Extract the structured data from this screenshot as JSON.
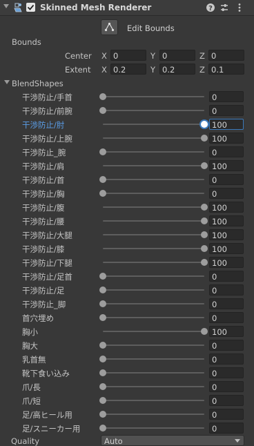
{
  "component": {
    "title": "Skinned Mesh Renderer",
    "enabled": true
  },
  "edit_bounds_label": "Edit Bounds",
  "bounds": {
    "label": "Bounds",
    "center": {
      "label": "Center",
      "x": "0",
      "y": "0",
      "z": "0"
    },
    "extent": {
      "label": "Extent",
      "x": "0.2",
      "y": "0.2",
      "z": "0.1"
    },
    "axis_labels": {
      "x": "X",
      "y": "Y",
      "z": "Z"
    }
  },
  "blendshapes": {
    "label": "BlendShapes",
    "items": [
      {
        "name": "干渉防止/手首",
        "value": "0"
      },
      {
        "name": "干渉防止/前腕",
        "value": "0"
      },
      {
        "name": "干渉防止/肘",
        "value": "100"
      },
      {
        "name": "干渉防止/上腕",
        "value": "100"
      },
      {
        "name": "干渉防止_腕",
        "value": "0"
      },
      {
        "name": "干渉防止/肩",
        "value": "100"
      },
      {
        "name": "干渉防止/首",
        "value": "0"
      },
      {
        "name": "干渉防止/胸",
        "value": "0"
      },
      {
        "name": "干渉防止/腹",
        "value": "100"
      },
      {
        "name": "干渉防止/腰",
        "value": "100"
      },
      {
        "name": "干渉防止/大腿",
        "value": "100"
      },
      {
        "name": "干渉防止/膝",
        "value": "100"
      },
      {
        "name": "干渉防止/下腿",
        "value": "100"
      },
      {
        "name": "干渉防止/足首",
        "value": "0"
      },
      {
        "name": "干渉防止/足",
        "value": "0"
      },
      {
        "name": "干渉防止_脚",
        "value": "0"
      },
      {
        "name": "首穴埋め",
        "value": "0"
      },
      {
        "name": "胸小",
        "value": "100"
      },
      {
        "name": "胸大",
        "value": "0"
      },
      {
        "name": "乳首無",
        "value": "0"
      },
      {
        "name": "靴下食い込み",
        "value": "0"
      },
      {
        "name": "爪/長",
        "value": "0"
      },
      {
        "name": "爪/短",
        "value": "0"
      },
      {
        "name": "足/高ヒール用",
        "value": "0"
      },
      {
        "name": "足/スニーカー用",
        "value": "0"
      }
    ]
  },
  "quality": {
    "label": "Quality",
    "value": "Auto"
  },
  "colors": {
    "accent": "#3a79bb",
    "focused_label": "#5b9ee8"
  }
}
